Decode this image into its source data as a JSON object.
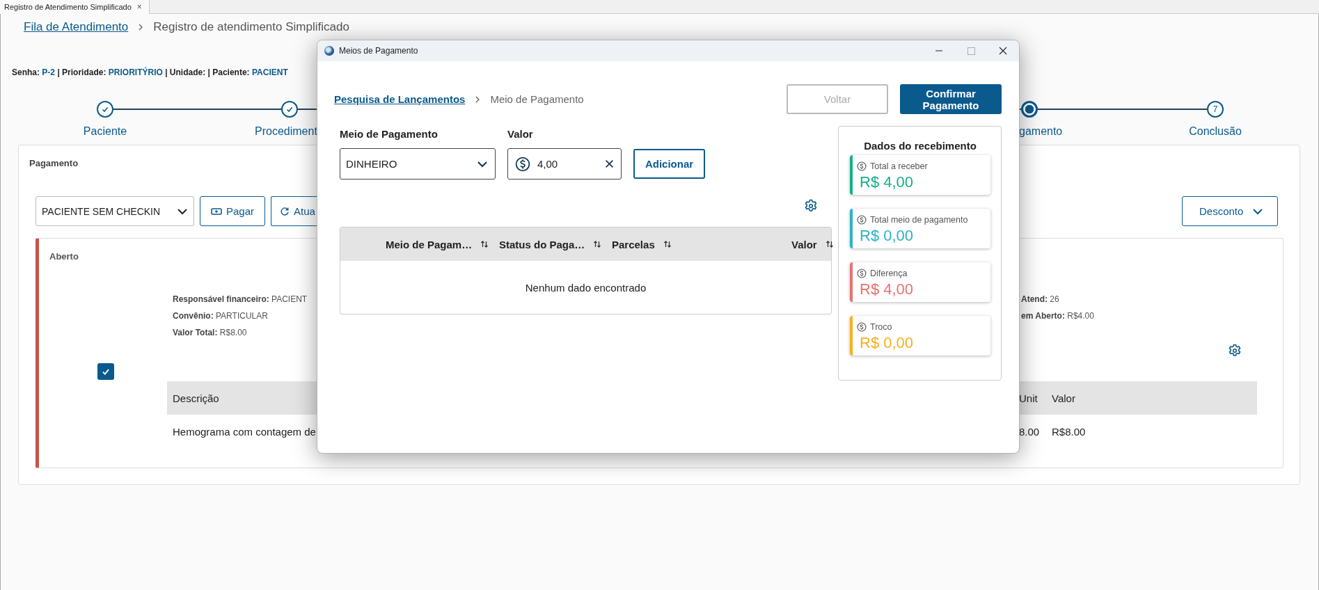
{
  "tab": {
    "title": "Registro de Atendimento Simplificado",
    "close": "×"
  },
  "breadcrumb": [
    {
      "label": "Fila de Atendimento",
      "link": true
    },
    {
      "label": "Registro de atendimento Simplificado",
      "link": false
    }
  ],
  "header_line": [
    {
      "text": "Senha:",
      "kind": "label"
    },
    {
      "text": "P-2",
      "kind": "value"
    },
    {
      "text": "|",
      "kind": "label"
    },
    {
      "text": "Prioridade:",
      "kind": "label"
    },
    {
      "text": "PRIORITÝRIO",
      "kind": "value"
    },
    {
      "text": "|",
      "kind": "label"
    },
    {
      "text": "Unidade:",
      "kind": "label"
    },
    {
      "text": "|",
      "kind": "label"
    },
    {
      "text": "Paciente:",
      "kind": "label"
    },
    {
      "text": "PACIENT",
      "kind": "value"
    }
  ],
  "stepper": [
    {
      "label": "Paciente",
      "completed": true,
      "current": false
    },
    {
      "label": "Procediment",
      "completed": true,
      "current": false
    },
    {
      "label": "gamento",
      "completed": false,
      "current": true
    },
    {
      "label": "Conclusão",
      "completed": false,
      "current": false,
      "number": "7"
    }
  ],
  "payment_section": {
    "title": "Pagamento",
    "patient_select": "PACIENTE SEM CHECKIN",
    "buttons": [
      "Pagar",
      "Atua"
    ],
    "discount_button": "Desconto",
    "invoice": {
      "status": "Aberto",
      "checked": true,
      "details_left": [
        "**Responsável financeiro:** PACIENT",
        "**Convênio:** PARTICULAR",
        "**Valor Total:** R$8.00"
      ],
      "details_right": [
        "**Atend:** 26",
        "**em Aberto:** R$4.00"
      ],
      "table": {
        "columns": [
          "Descrição",
          "Unit",
          "Valor"
        ],
        "rows": [
          [
            "Hemograma com contagem de",
            "8.00",
            "R$8.00"
          ]
        ]
      }
    }
  },
  "dialog": {
    "title": "Meios de Pagamento",
    "breadcrumb": [
      {
        "label": "Pesquisa de Lançamentos",
        "link": true
      },
      {
        "label": "Meio de Pagamento",
        "link": false
      }
    ],
    "buttons": [
      {
        "label": "Voltar",
        "kind": "secondary",
        "disabled": true
      },
      {
        "label": "Confirmar Pagamento",
        "kind": "primary",
        "disabled": false
      }
    ],
    "method_field": {
      "label": "Meio de Pagamento",
      "value": "DINHEIRO"
    },
    "amount_field": {
      "label": "Valor",
      "value": "4,00"
    },
    "add_button": "Adicionar",
    "table": {
      "columns": [
        "Meio de Pagam…",
        "Status do Paga…",
        "Parcelas",
        "Valor"
      ],
      "empty_message": "Nenhum dado encontrado"
    },
    "summary": {
      "title": "Dados do recebimento",
      "cards": [
        {
          "label": "Total a receber",
          "amount": "R$ 4,00",
          "color": "#14b08a"
        },
        {
          "label": "Total meio de pagamento",
          "amount": "R$ 0,00",
          "color": "#2bb3c6"
        },
        {
          "label": "Diferença",
          "amount": "R$ 4,00",
          "color": "#e8716f"
        },
        {
          "label": "Troco",
          "amount": "R$ 0,00",
          "color": "#f5b11c"
        }
      ]
    }
  }
}
